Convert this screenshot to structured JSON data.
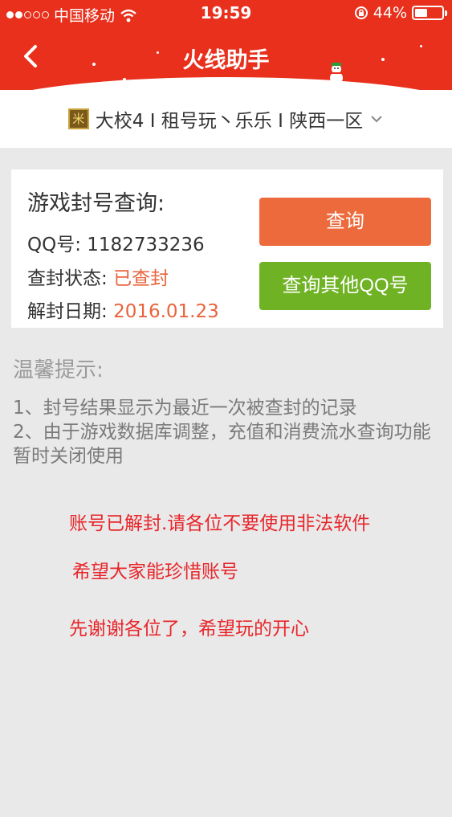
{
  "status_bar": {
    "carrier": "中国移动",
    "time": "19:59",
    "battery_percent": "44%",
    "battery_level": 0.44,
    "signal_bars_filled": 2,
    "signal_bars_total": 5
  },
  "nav": {
    "title": "火线助手",
    "back_icon": "chevron-left-icon",
    "accent_color": "#e8301c"
  },
  "server": {
    "name": "大校4 I 租号玩丶乐乐 I 陕西一区",
    "game_icon_glyph": "米"
  },
  "query_card": {
    "title": "游戏封号查询:",
    "qq_label": "QQ号: ",
    "qq_value": "1182733236",
    "status_label": "查封状态: ",
    "status_value": "已查封",
    "date_label": "解封日期: ",
    "date_value": "2016.01.23",
    "query_button": "查询",
    "other_button": "查询其他QQ号",
    "query_button_color": "#ec6a3c",
    "other_button_color": "#6fb224"
  },
  "tips": {
    "title": "温馨提示:",
    "line1": "1、封号结果显示为最近一次被查封的记录",
    "line2": "2、由于游戏数据库调整，充值和消费流水查询功能暂时关闭使用"
  },
  "overlay_text": {
    "line1": "账号已解封.请各位不要使用非法软件",
    "line2": "希望大家能珍惜账号",
    "line3": "先谢谢各位了，希望玩的开心",
    "color": "#e8262a"
  }
}
